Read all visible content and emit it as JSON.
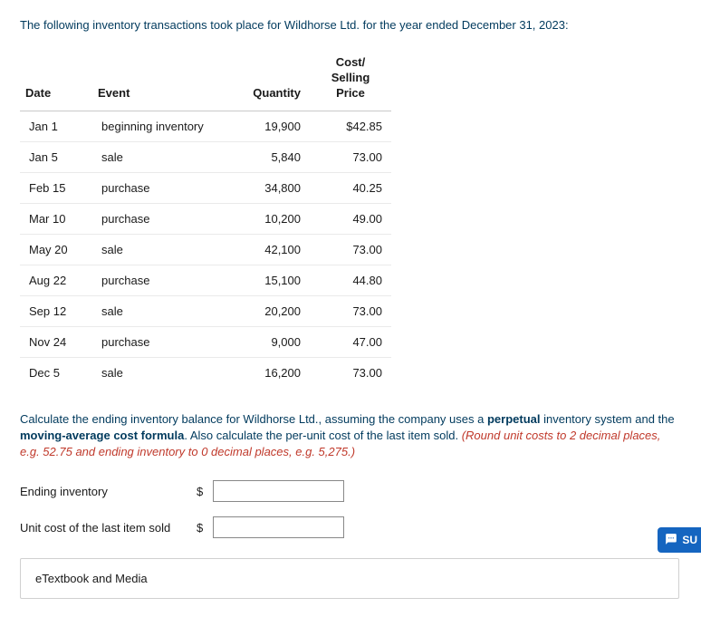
{
  "intro": "The following inventory transactions took place for Wildhorse Ltd. for the year ended December 31, 2023:",
  "headers": {
    "date": "Date",
    "event": "Event",
    "qty": "Quantity",
    "price_l1": "Cost/",
    "price_l2": "Selling",
    "price_l3": "Price"
  },
  "rows": [
    {
      "date": "Jan 1",
      "event": "beginning inventory",
      "qty": "19,900",
      "price": "$42.85"
    },
    {
      "date": "Jan 5",
      "event": "sale",
      "qty": "5,840",
      "price": "73.00"
    },
    {
      "date": "Feb 15",
      "event": "purchase",
      "qty": "34,800",
      "price": "40.25"
    },
    {
      "date": "Mar 10",
      "event": "purchase",
      "qty": "10,200",
      "price": "49.00"
    },
    {
      "date": "May 20",
      "event": "sale",
      "qty": "42,100",
      "price": "73.00"
    },
    {
      "date": "Aug 22",
      "event": "purchase",
      "qty": "15,100",
      "price": "44.80"
    },
    {
      "date": "Sep 12",
      "event": "sale",
      "qty": "20,200",
      "price": "73.00"
    },
    {
      "date": "Nov 24",
      "event": "purchase",
      "qty": "9,000",
      "price": "47.00"
    },
    {
      "date": "Dec 5",
      "event": "sale",
      "qty": "16,200",
      "price": "73.00"
    }
  ],
  "instructions": {
    "part1": "Calculate the ending inventory balance for Wildhorse Ltd., assuming the company uses a ",
    "bold1": "perpetual",
    "part2": " inventory system and the ",
    "bold2": "moving-average cost formula",
    "part3": ". Also calculate the per-unit cost of the last item sold. ",
    "red": "(Round unit costs to 2 decimal places, e.g. 52.75 and ending inventory to 0 decimal places, e.g. 5,275.)"
  },
  "inputs": {
    "ending_label": "Ending inventory",
    "unitcost_label": "Unit cost of the last item sold",
    "currency": "$",
    "ending_value": "",
    "unitcost_value": ""
  },
  "etext_label": "eTextbook and Media",
  "badge_text": "SU"
}
